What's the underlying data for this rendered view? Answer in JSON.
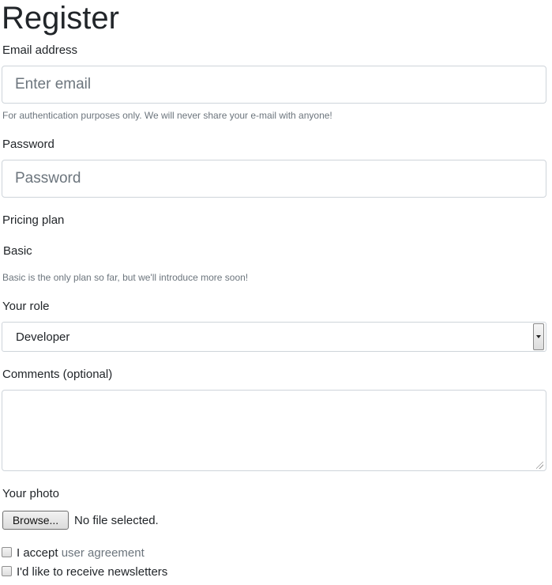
{
  "form": {
    "title": "Register",
    "email": {
      "label": "Email address",
      "placeholder": "Enter email",
      "value": "",
      "help": "For authentication purposes only. We will never share your e-mail with anyone!"
    },
    "password": {
      "label": "Password",
      "placeholder": "Password",
      "value": ""
    },
    "pricing_plan": {
      "label": "Pricing plan",
      "value": "Basic",
      "help": "Basic is the only plan so far, but we'll introduce more soon!"
    },
    "role": {
      "label": "Your role",
      "selected": "Developer"
    },
    "comments": {
      "label": "Comments (optional)",
      "value": ""
    },
    "photo": {
      "label": "Your photo",
      "button_label": "Browse...",
      "status": "No file selected."
    },
    "agreement": {
      "prefix": "I accept",
      "link_text": "user agreement",
      "checked": false
    },
    "newsletter": {
      "label": "I'd like to receive newsletters",
      "checked": false
    }
  }
}
